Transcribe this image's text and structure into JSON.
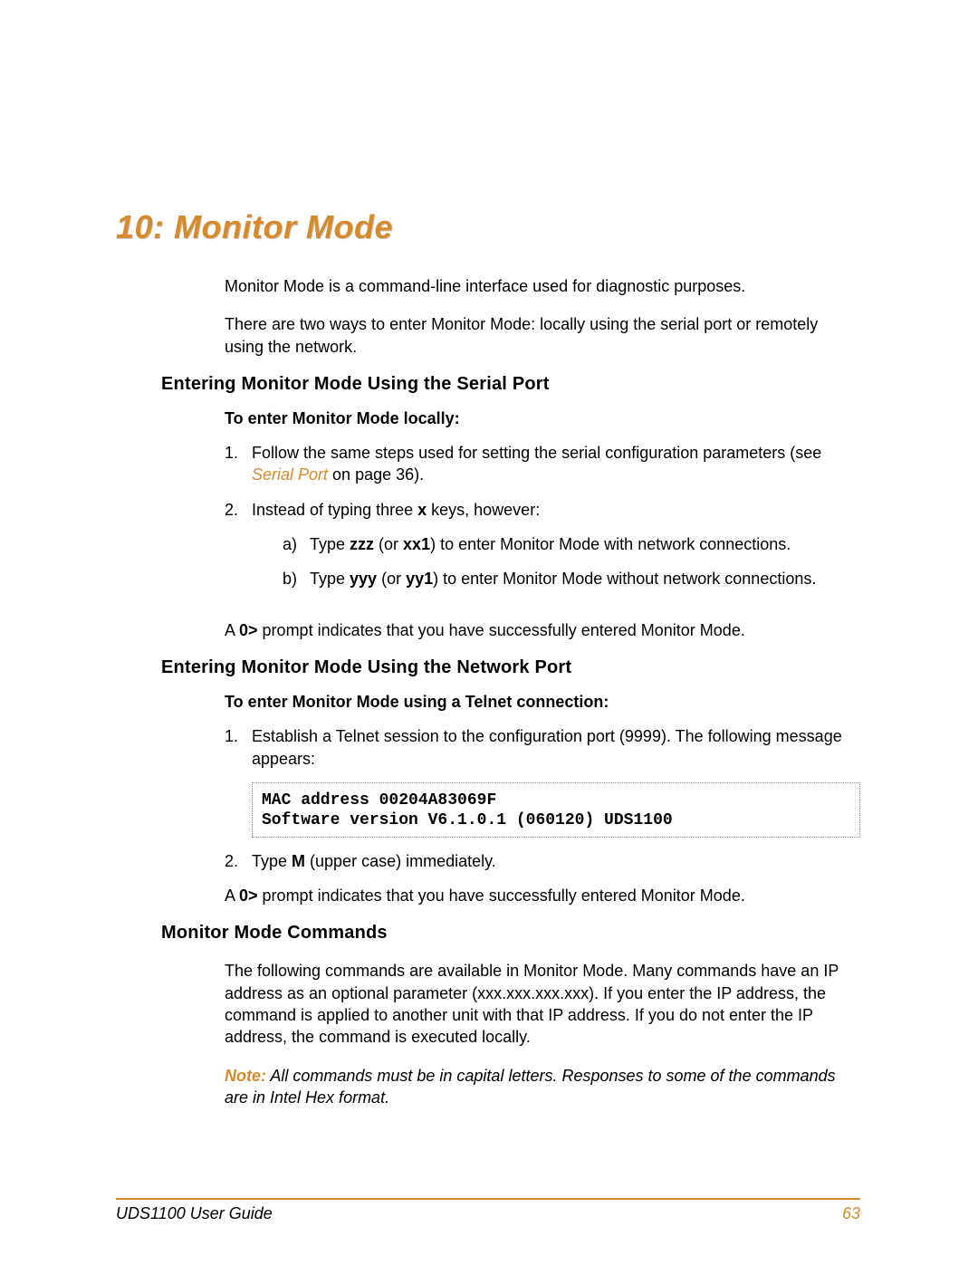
{
  "chapter": {
    "title": "10: Monitor Mode"
  },
  "intro": {
    "p1": "Monitor Mode is a command-line interface used for diagnostic purposes.",
    "p2": "There are two ways to enter Monitor Mode: locally using the serial port or remotely using the network."
  },
  "section_serial": {
    "heading": "Entering Monitor Mode Using the Serial Port",
    "subheading": "To enter Monitor Mode locally:",
    "step1": {
      "num": "1.",
      "pre": "Follow the same steps used for setting the serial configuration parameters (see ",
      "link": "Serial Port",
      "post": " on page 36)."
    },
    "step2": {
      "num": "2.",
      "text_pre": "Instead of typing three ",
      "x": "x",
      "text_post": " keys, however:",
      "a": {
        "num": "a)",
        "pre": "Type ",
        "b1": "zzz",
        "mid": " (or ",
        "b2": "xx1",
        "post": ") to enter Monitor Mode with network connections."
      },
      "b": {
        "num": "b)",
        "pre": "Type ",
        "b1": "yyy",
        "mid": " (or ",
        "b2": "yy1",
        "post": ") to enter Monitor Mode without network connections."
      }
    },
    "prompt": {
      "pre": "A ",
      "b": "0>",
      "post": " prompt indicates that you have successfully entered Monitor Mode."
    }
  },
  "section_network": {
    "heading": "Entering Monitor Mode Using the Network Port",
    "subheading": "To enter Monitor Mode using a Telnet connection:",
    "step1": {
      "num": "1.",
      "text": "Establish a Telnet session to the configuration port (9999). The following message appears:"
    },
    "code": "MAC address 00204A83069F\nSoftware version V6.1.0.1 (060120) UDS1100",
    "step2": {
      "num": "2.",
      "pre": "Type ",
      "b": "M",
      "post": " (upper case) immediately."
    },
    "prompt": {
      "pre": "A  ",
      "b": "0>",
      "post": " prompt indicates that you have successfully entered Monitor Mode."
    }
  },
  "section_commands": {
    "heading": "Monitor Mode Commands",
    "para": "The following commands are available in Monitor Mode. Many commands have an IP address as an optional parameter (xxx.xxx.xxx.xxx). If you enter the IP address, the command is applied to another unit with that IP address. If you do not enter the IP address, the command is executed locally.",
    "note_label": "Note:",
    "note_text": " All commands must be in capital letters. Responses to some of the commands are in Intel Hex format."
  },
  "footer": {
    "guide": "UDS1100 User Guide",
    "page": "63"
  }
}
